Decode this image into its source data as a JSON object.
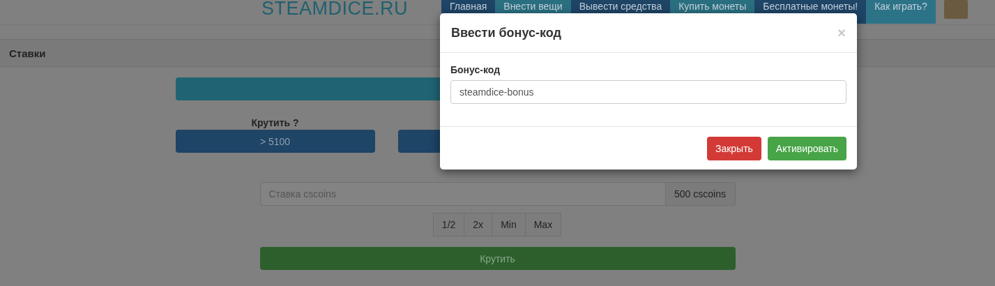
{
  "logo": "STEAMDICE.RU",
  "nav": [
    {
      "label": "Главная",
      "color": "#1e4466"
    },
    {
      "label": "Внести вещи",
      "color": "#2a6f80"
    },
    {
      "label": "Вывести средства",
      "color": "#1e4466"
    },
    {
      "label": "Купить монеты",
      "color": "#2a6f80"
    },
    {
      "label": "Бесплатные монеты!",
      "color": "#1e4466"
    },
    {
      "label": "Как играть?",
      "color": "#2d7388"
    }
  ],
  "panel": {
    "title": "Ставки"
  },
  "spin_label": "Крутить  ?",
  "choices": [
    "> 5100"
  ],
  "bet": {
    "placeholder": "Ставка cscoins",
    "addon": "500 cscoins"
  },
  "multipliers": [
    "1/2",
    "2x",
    "Min",
    "Max"
  ],
  "spin_button": "Крутить",
  "modal": {
    "title": "Ввести бонус-код",
    "close": "×",
    "field_label": "Бонус-код",
    "value": "steamdice-bonus",
    "buttons": [
      {
        "label": "Закрыть",
        "kind": "danger"
      },
      {
        "label": "Активировать",
        "kind": "success"
      }
    ]
  }
}
